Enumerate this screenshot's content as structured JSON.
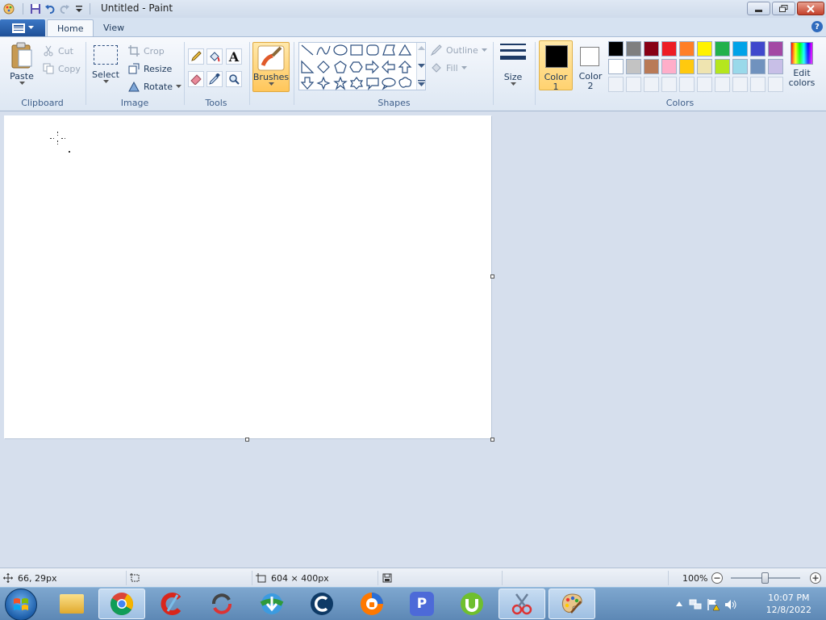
{
  "window": {
    "title": "Untitled - Paint"
  },
  "tabs": {
    "home": "Home",
    "view": "View"
  },
  "clipboard": {
    "group": "Clipboard",
    "paste": "Paste",
    "cut": "Cut",
    "copy": "Copy"
  },
  "image": {
    "group": "Image",
    "select": "Select",
    "crop": "Crop",
    "resize": "Resize",
    "rotate": "Rotate"
  },
  "tools": {
    "group": "Tools"
  },
  "brushes": {
    "label": "Brushes"
  },
  "shapes": {
    "group": "Shapes",
    "outline": "Outline",
    "fill": "Fill"
  },
  "size": {
    "label": "Size"
  },
  "colors": {
    "group": "Colors",
    "color1_line1": "Color",
    "color1_line2": "1",
    "color2_line1": "Color",
    "color2_line2": "2",
    "edit_line1": "Edit",
    "edit_line2": "colors",
    "color1_value": "#000000",
    "color2_value": "#ffffff",
    "palette_row1": [
      "#000000",
      "#7f7f7f",
      "#880015",
      "#ed1c24",
      "#ff7f27",
      "#fff200",
      "#22b14c",
      "#00a2e8",
      "#3f48cc",
      "#a349a4"
    ],
    "palette_row2": [
      "#ffffff",
      "#c3c3c3",
      "#b97a57",
      "#ffaec9",
      "#ffc90e",
      "#efe4b0",
      "#b5e61d",
      "#99d9ea",
      "#7092be",
      "#c8bfe7"
    ]
  },
  "status": {
    "cursor_pos": "66, 29px",
    "image_size": "604 × 400px",
    "zoom": "100%",
    "zoom_fraction": 0.5
  },
  "taskbar": {
    "apps": [
      "windows-explorer",
      "chrome",
      "ccleaner",
      "app-sync",
      "internet-download-manager",
      "ccleaner-browser",
      "avast-secure-browser",
      "pdf-app",
      "utorrent",
      "snipping-tool",
      "paint"
    ],
    "time": "10:07 PM",
    "date": "12/8/2022"
  }
}
